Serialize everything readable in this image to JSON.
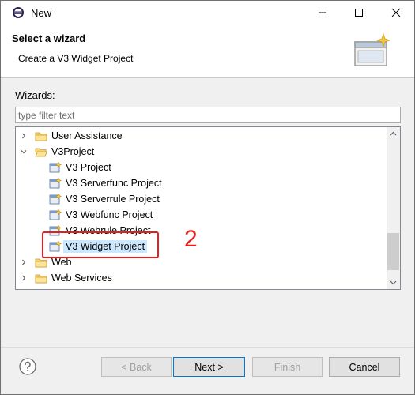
{
  "window": {
    "title": "New"
  },
  "banner": {
    "title": "Select a wizard",
    "description": "Create a V3 Widget Project"
  },
  "wizards_label": "Wizards:",
  "filter": {
    "value": "",
    "placeholder": "type filter text"
  },
  "tree": {
    "items": [
      {
        "label": "User Assistance",
        "level": 0,
        "type": "folder",
        "expanded": false
      },
      {
        "label": "V3Project",
        "level": 0,
        "type": "folder",
        "expanded": true
      },
      {
        "label": "V3 Project",
        "level": 1,
        "type": "wizard"
      },
      {
        "label": "V3 Serverfunc Project",
        "level": 1,
        "type": "wizard"
      },
      {
        "label": "V3 Serverrule Project",
        "level": 1,
        "type": "wizard"
      },
      {
        "label": "V3 Webfunc Project",
        "level": 1,
        "type": "wizard"
      },
      {
        "label": "V3 Webrule Project",
        "level": 1,
        "type": "wizard"
      },
      {
        "label": "V3 Widget Project",
        "level": 1,
        "type": "wizard",
        "selected": true
      },
      {
        "label": "Web",
        "level": 0,
        "type": "folder",
        "expanded": false
      },
      {
        "label": "Web Services",
        "level": 0,
        "type": "folder",
        "expanded": false
      }
    ]
  },
  "annotation": {
    "step": "2",
    "color": "#e81e1e"
  },
  "buttons": {
    "back": "< Back",
    "next": "Next >",
    "finish": "Finish",
    "cancel": "Cancel"
  },
  "colors": {
    "selection": "#cce8ff",
    "accent": "#0078d7"
  }
}
